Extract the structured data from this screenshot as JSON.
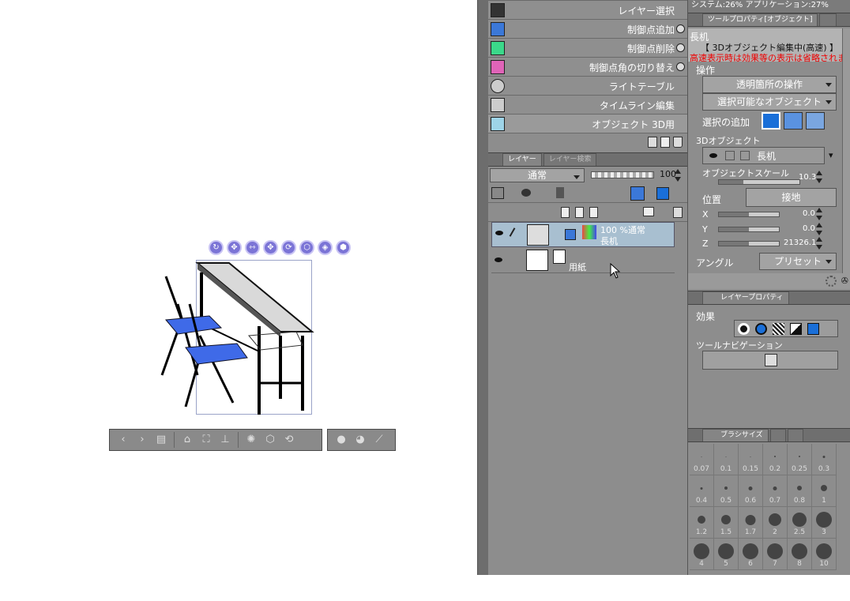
{
  "status_bar": "システム:26% アプリケーション:27%",
  "canvas": {
    "gizmo_icons": [
      "camera-rotate-icon",
      "camera-pan-icon",
      "camera-dolly-icon",
      "object-move-icon",
      "object-rotate-icon",
      "object-rotate-3d-icon",
      "object-pan-icon",
      "object-scale-icon"
    ],
    "toolbar_icons": [
      "prev-icon",
      "next-icon",
      "material-list-icon",
      "camera-icon",
      "fit-icon",
      "ground-icon",
      "reset-pose-icon",
      "register-icon",
      "rotate-icon",
      "light-icon",
      "lens-icon",
      "bone-icon"
    ]
  },
  "tool_list": {
    "items": [
      {
        "label": "レイヤー選択",
        "icon_color": "#333333"
      },
      {
        "label": "制御点追加",
        "icon_color": "#3b78d8"
      },
      {
        "label": "制御点削除",
        "icon_color": "#3bd88a"
      },
      {
        "label": "制御点角の切り替え",
        "icon_color": "#e064b8"
      },
      {
        "label": "ライトテーブル",
        "icon_color": "#cccccc"
      },
      {
        "label": "タイムライン編集",
        "icon_color": "#cccccc"
      },
      {
        "label": "オブジェクト 3D用",
        "icon_color": "#9ed4e8"
      }
    ]
  },
  "layer_panel": {
    "tabs": [
      "レイヤー",
      "レイヤー検索"
    ],
    "blend_mode": "通常",
    "opacity": "100",
    "layers": [
      {
        "title": "100 %通常",
        "name": "長机",
        "selected": true
      },
      {
        "title": "",
        "name": "用紙",
        "selected": false
      }
    ]
  },
  "tool_property": {
    "tab": "ツールプロパティ[オブジェクト]",
    "object_name": "長机",
    "banner_line1": "【 3Dオブジェクト編集中(高速) 】",
    "banner_line2": "高速表示時は効果等の表示は省略されます",
    "section_operation": "操作",
    "transparent_op": "透明箇所の操作",
    "selectable_obj": "選択可能なオブジェクト",
    "add_selection_label": "選択の追加",
    "section_3d": "3Dオブジェクト",
    "object_item": "長机",
    "scale_label": "オブジェクトスケール",
    "scale_value": "10.3",
    "position_label": "位置",
    "ground_button": "接地",
    "x_label": "X",
    "x_value": "0.0",
    "y_label": "Y",
    "y_value": "0.0",
    "z_label": "Z",
    "z_value": "21326.1",
    "angle_label": "アングル",
    "preset_button": "プリセット"
  },
  "layer_property": {
    "tab": "レイヤープロパティ",
    "effect_label": "効果",
    "tool_nav_label": "ツールナビゲーション"
  },
  "brush_size": {
    "tab": "ブラシサイズ",
    "sizes": [
      "0.07",
      "0.1",
      "0.15",
      "0.2",
      "0.25",
      "0.3",
      "0.4",
      "0.5",
      "0.6",
      "0.7",
      "0.8",
      "1",
      "1.2",
      "1.5",
      "1.7",
      "2",
      "2.5",
      "3",
      "4",
      "5",
      "6",
      "7",
      "8",
      "10"
    ]
  },
  "colors": {
    "panel_bg": "#8d8d8d",
    "selected_layer": "#a8bfd0",
    "banner_red": "#e00000",
    "accent_blue": "#1a6fd8"
  }
}
